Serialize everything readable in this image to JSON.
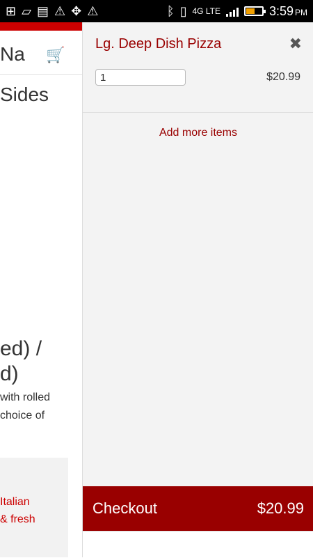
{
  "status_bar": {
    "time": "3:59",
    "ampm": "PM",
    "network": "4G LTE",
    "icons": [
      "add-icon",
      "broken-image-icon",
      "picture-icon",
      "warning-icon",
      "dropbox-icon",
      "warning-icon",
      "bluetooth-icon",
      "vibrate-icon",
      "signal-icon",
      "battery-icon"
    ]
  },
  "background_page": {
    "header_text": "Na",
    "cart_icon": "cart-icon",
    "sides_text": "Sides",
    "heading_line1": "ed) /",
    "heading_line2": "d)",
    "desc_line1": "with rolled",
    "desc_line2": "choice of",
    "promo_line1": "Italian",
    "promo_line2": "& fresh"
  },
  "cart": {
    "item_name": "Lg. Deep Dish Pizza",
    "quantity": "1",
    "price": "$20.99",
    "add_more": "Add more items",
    "checkout_label": "Checkout",
    "checkout_total": "$20.99"
  },
  "colors": {
    "accent": "#990000",
    "brand_red": "#cc0000",
    "panel_bg": "#f3f3f3"
  }
}
